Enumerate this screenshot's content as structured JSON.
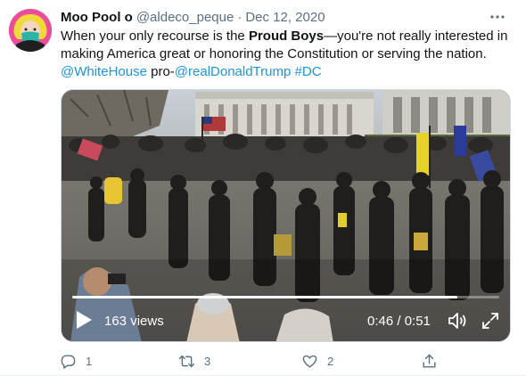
{
  "tweet": {
    "display_name": "Moo Pool o",
    "handle": "@aldeco_peque",
    "separator": "·",
    "date": "Dec 12, 2020",
    "text": {
      "t1": "When your only recourse is the ",
      "bold": "Proud Boys",
      "t2": "—you're not really interested in making America great or honoring the Constitution or serving the nation.",
      "mention1": "@WhiteHouse",
      "t3": " pro-",
      "mention2": "@realDonaldTrump",
      "t4": " ",
      "hashtag": "#DC"
    }
  },
  "video": {
    "views": "163 views",
    "time": "0:46 / 0:51",
    "progress_fraction": 0.902
  },
  "actions": {
    "reply_count": "1",
    "retweet_count": "3",
    "like_count": "2"
  },
  "colors": {
    "link": "#1b95e0",
    "muted": "#5b7083",
    "text": "#0f1419"
  },
  "icons": {
    "more": "ellipsis-icon",
    "reply": "comment-icon",
    "retweet": "retweet-icon",
    "like": "heart-icon",
    "share": "share-icon",
    "play": "play-icon",
    "volume": "volume-icon",
    "fullscreen": "fullscreen-icon"
  }
}
